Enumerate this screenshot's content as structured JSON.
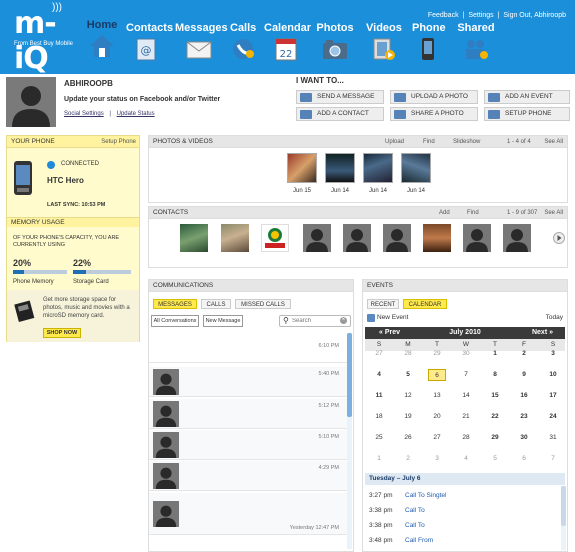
{
  "brand": {
    "logo_text": "m-iQ",
    "tagline": "From Best Buy Mobile",
    "accent": "#1b8fd9",
    "highlight": "#ffe94d"
  },
  "toplinks": {
    "feedback": "Feedback",
    "sep1": "|",
    "settings": "Settings",
    "sep2": "|",
    "signout": "Sign Out, Abhiroopb"
  },
  "nav": [
    {
      "label": "Home",
      "icon": "house-icon"
    },
    {
      "label": "Contacts",
      "icon": "contacts-card-icon"
    },
    {
      "label": "Messages",
      "icon": "envelope-icon"
    },
    {
      "label": "Calls",
      "icon": "phone-handset-icon"
    },
    {
      "label": "Calendar",
      "icon": "calendar-icon",
      "badge": "22"
    },
    {
      "label": "Photos",
      "icon": "camera-icon"
    },
    {
      "label": "Videos",
      "icon": "film-icon"
    },
    {
      "label": "Phone",
      "icon": "phone-device-icon"
    },
    {
      "label": "Shared",
      "icon": "people-icon"
    }
  ],
  "profile": {
    "name": "ABHIROOPB",
    "status_prompt": "Update your status on Facebook and/or Twitter",
    "social_settings": "Social Settings",
    "sep": "|",
    "update_status": "Update Status"
  },
  "iwant": {
    "title": "I WANT TO...",
    "actions": [
      "SEND A MESSAGE",
      "UPLOAD A PHOTO",
      "ADD AN EVENT",
      "ADD A CONTACT",
      "SHARE A PHOTO",
      "SETUP PHONE"
    ]
  },
  "yourphone": {
    "title": "YOUR PHONE",
    "setup": "Setup Phone",
    "connected": "CONNECTED",
    "model": "HTC Hero",
    "last_sync": "LAST SYNC: 10:53 PM",
    "memory_title": "MEMORY USAGE",
    "memory_desc": "OF YOUR PHONE'S CAPACITY, YOU ARE CURRENTLY USING",
    "phone_memory_pct": "20%",
    "phone_memory_fill": 0.2,
    "phone_memory_label": "Phone Memory",
    "storage_pct": "22%",
    "storage_fill": 0.22,
    "storage_label": "Storage Card",
    "promo": "Get more storage space for photos, music and movies with a microSD memory card.",
    "shop": "SHOP NOW"
  },
  "photos": {
    "title": "PHOTOS & VIDEOS",
    "upload": "Upload",
    "find": "Find",
    "slideshow": "Slideshow",
    "range": "1 - 4 of 4",
    "see_all": "See All",
    "items": [
      "Jun 15",
      "Jun 14",
      "Jun 14",
      "Jun 14"
    ]
  },
  "contacts": {
    "title": "CONTACTS",
    "add": "Add",
    "find": "Find",
    "range": "1 - 9 of 307",
    "see_all": "See All"
  },
  "communications": {
    "title": "COMMUNICATIONS",
    "tabs": [
      "MESSAGES",
      "CALLS",
      "MISSED CALLS"
    ],
    "all_conv": "All Conversations",
    "new_msg": "New Message",
    "search_placeholder": "Search",
    "times": [
      "6:10 PM",
      "5:40 PM",
      "5:12 PM",
      "5:10 PM",
      "4:29 PM",
      "Yesterday 12:47 PM"
    ]
  },
  "events": {
    "title": "EVENTS",
    "tabs": [
      "RECENT",
      "CALENDAR"
    ],
    "new_event": "New Event",
    "today": "Today",
    "prev": "« Prev",
    "month": "July 2010",
    "next": "Next »",
    "dow": [
      "S",
      "M",
      "T",
      "W",
      "T",
      "F",
      "S"
    ],
    "weeks": [
      [
        "27",
        "28",
        "29",
        "30",
        "1",
        "2",
        "3"
      ],
      [
        "4",
        "5",
        "6",
        "7",
        "8",
        "9",
        "10"
      ],
      [
        "11",
        "12",
        "13",
        "14",
        "15",
        "16",
        "17"
      ],
      [
        "18",
        "19",
        "20",
        "21",
        "22",
        "23",
        "24"
      ],
      [
        "25",
        "26",
        "27",
        "28",
        "29",
        "30",
        "31"
      ],
      [
        "1",
        "2",
        "3",
        "4",
        "5",
        "6",
        "7"
      ]
    ],
    "day_header": "Tuesday – July 6",
    "list": [
      {
        "time": "3:27 pm",
        "desc": "Call To Singtel"
      },
      {
        "time": "3:38 pm",
        "desc": "Call To"
      },
      {
        "time": "3:38 pm",
        "desc": "Call To"
      },
      {
        "time": "3:48 pm",
        "desc": "Call From"
      }
    ]
  }
}
